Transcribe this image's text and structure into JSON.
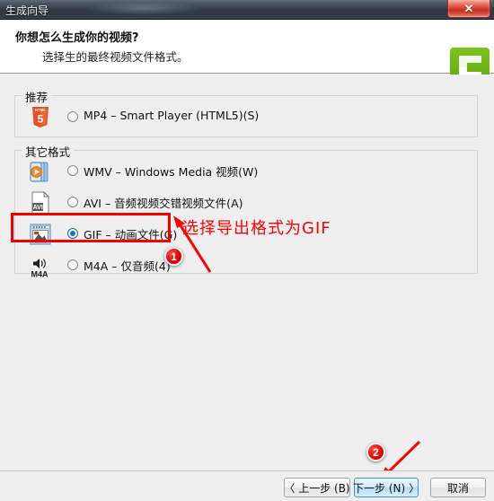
{
  "window": {
    "title": "生成向导",
    "close_label": "✕"
  },
  "header": {
    "title": "你想怎么生成你的视频?",
    "subtitle": "选择生的最终视频文件格式。",
    "logo_name": "camtasia-logo"
  },
  "groups": [
    {
      "label": "推荐",
      "options": [
        {
          "id": "mp4",
          "icon": "html5-icon",
          "label": "MP4 – Smart Player  (HTML5)(S)",
          "selected": false
        }
      ]
    },
    {
      "label": "其它格式",
      "options": [
        {
          "id": "wmv",
          "icon": "windows-media-icon",
          "label": "WMV – Windows Media 视频(W)",
          "selected": false
        },
        {
          "id": "avi",
          "icon": "avi-file-icon",
          "label": "AVI – 音频视频交错视频文件(A)",
          "selected": false
        },
        {
          "id": "gif",
          "icon": "gif-animation-icon",
          "label": "GIF – 动画文件(G)",
          "selected": true
        },
        {
          "id": "m4a",
          "icon": "m4a-audio-icon",
          "label": "M4A – 仅音频(4)",
          "selected": false
        }
      ]
    }
  ],
  "annotations": {
    "text": "选择导出格式为GIF",
    "badge_one": "1",
    "badge_two": "2",
    "color": "#ff0000"
  },
  "footer": {
    "back_label": "〈 上一步 (B)",
    "next_label": "下一步 (N) 〉",
    "cancel_label": "取消"
  }
}
